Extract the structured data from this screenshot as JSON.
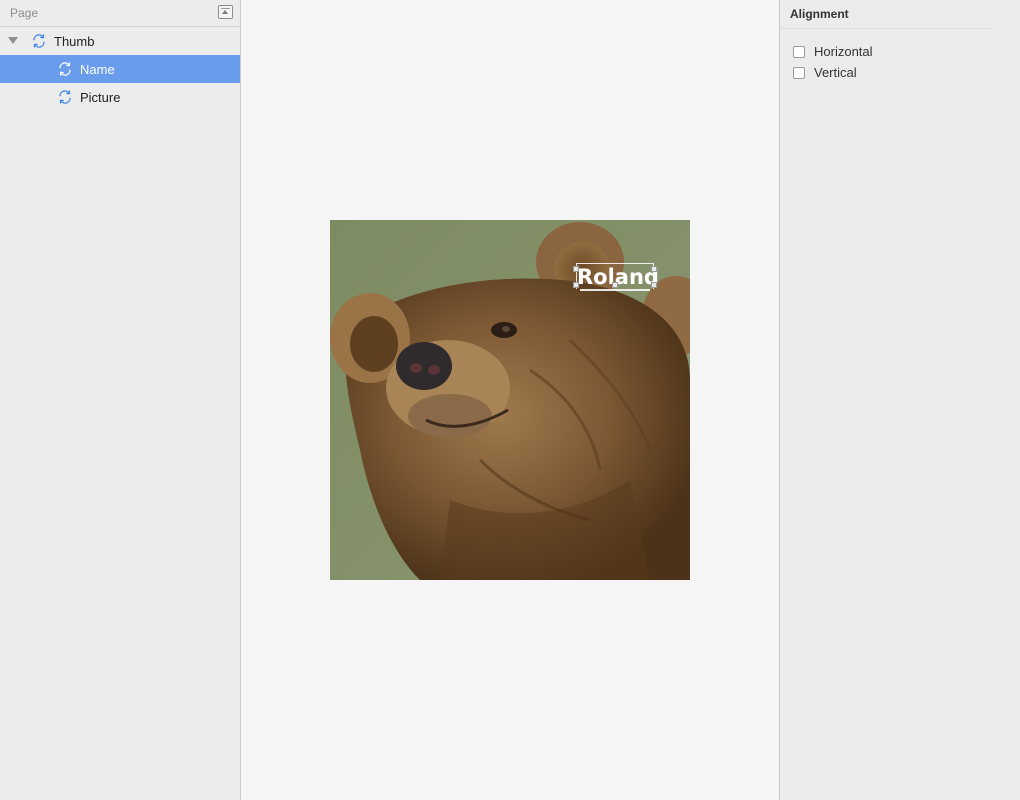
{
  "layers_panel": {
    "title": "Page",
    "items": [
      {
        "label": "Thumb",
        "icon": "symbol-icon",
        "expanded": true,
        "selected": false,
        "depth": 0
      },
      {
        "label": "Name",
        "icon": "symbol-icon",
        "selected": true,
        "depth": 1
      },
      {
        "label": "Picture",
        "icon": "symbol-icon",
        "selected": false,
        "depth": 1
      }
    ]
  },
  "canvas": {
    "artboard_text": "Roland"
  },
  "inspector": {
    "section_title": "Alignment",
    "options": [
      {
        "label": "Horizontal",
        "checked": false
      },
      {
        "label": "Vertical",
        "checked": false
      }
    ]
  },
  "colors": {
    "selection": "#6a9cec",
    "symbol_icon": "#3d86e8"
  }
}
